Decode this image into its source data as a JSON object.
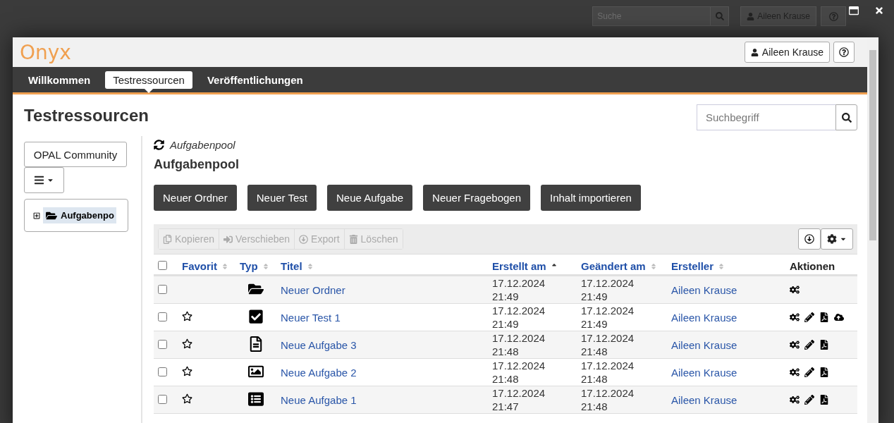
{
  "backdrop": {
    "search": {
      "placeholder": "Suche"
    },
    "user": "Aileen Krause"
  },
  "dialog": {
    "logo": "Onyx",
    "user": "Aileen Krause",
    "tabs": [
      {
        "label": "Willkommen",
        "selected": false
      },
      {
        "label": "Testressourcen",
        "selected": true
      },
      {
        "label": "Veröffentlichungen",
        "selected": false
      }
    ],
    "title": "Testressourcen",
    "search": {
      "placeholder": "Suchbegriff"
    },
    "sidebar": {
      "community": "OPAL Community",
      "tree": [
        {
          "label": "Aufgabenpo",
          "selected": true,
          "expanded": false
        }
      ]
    },
    "breadcrumb": "Aufgabenpool",
    "heading": "Aufgabenpool",
    "create_buttons": [
      "Neuer Ordner",
      "Neuer Test",
      "Neue Aufgabe",
      "Neuer Fragebogen",
      "Inhalt importieren"
    ],
    "toolbar": [
      {
        "kind": "copy",
        "label": "Kopieren",
        "disabled": true
      },
      {
        "kind": "move",
        "label": "Verschieben",
        "disabled": true
      },
      {
        "kind": "export",
        "label": "Export",
        "disabled": true
      },
      {
        "kind": "delete",
        "label": "Löschen",
        "disabled": true
      }
    ],
    "table": {
      "select_all": {
        "checked": false
      },
      "columns": [
        {
          "label": "Favorit",
          "sortable": true,
          "sorted": false
        },
        {
          "label": "Typ",
          "sortable": true,
          "sorted": false
        },
        {
          "label": "Titel",
          "sortable": true,
          "sorted": false
        },
        {
          "label": "Erstellt am",
          "sortable": true,
          "sorted": true
        },
        {
          "label": "Geändert am",
          "sortable": true,
          "sorted": false
        },
        {
          "label": "Ersteller",
          "sortable": true,
          "sorted": false
        },
        {
          "label": "Aktionen",
          "sortable": false
        }
      ],
      "rows": [
        {
          "checked": false,
          "kind": "folder",
          "title": "Neuer Ordner",
          "created": "17.12.2024 21:49",
          "modified": "17.12.2024 21:49",
          "creator": "Aileen Krause",
          "actions": [
            {
              "kind": "settings"
            }
          ]
        },
        {
          "checked": false,
          "starred": false,
          "kind": "test",
          "title": "Neuer Test 1",
          "created": "17.12.2024 21:49",
          "modified": "17.12.2024 21:49",
          "creator": "Aileen Krause",
          "actions": [
            {
              "kind": "settings"
            },
            {
              "kind": "edit"
            },
            {
              "kind": "pdf"
            },
            {
              "kind": "upload"
            }
          ]
        },
        {
          "checked": false,
          "starred": false,
          "kind": "text_task",
          "title": "Neue Aufgabe 3",
          "created": "17.12.2024 21:48",
          "modified": "17.12.2024 21:48",
          "creator": "Aileen Krause",
          "actions": [
            {
              "kind": "settings"
            },
            {
              "kind": "edit"
            },
            {
              "kind": "pdf"
            }
          ]
        },
        {
          "checked": false,
          "starred": false,
          "kind": "image_task",
          "title": "Neue Aufgabe 2",
          "created": "17.12.2024 21:48",
          "modified": "17.12.2024 21:48",
          "creator": "Aileen Krause",
          "actions": [
            {
              "kind": "settings"
            },
            {
              "kind": "edit"
            },
            {
              "kind": "pdf"
            }
          ]
        },
        {
          "checked": false,
          "starred": false,
          "kind": "form_task",
          "title": "Neue Aufgabe 1",
          "created": "17.12.2024 21:47",
          "modified": "17.12.2024 21:48",
          "creator": "Aileen Krause",
          "actions": [
            {
              "kind": "settings"
            },
            {
              "kind": "edit"
            },
            {
              "kind": "pdf"
            }
          ]
        }
      ]
    }
  }
}
